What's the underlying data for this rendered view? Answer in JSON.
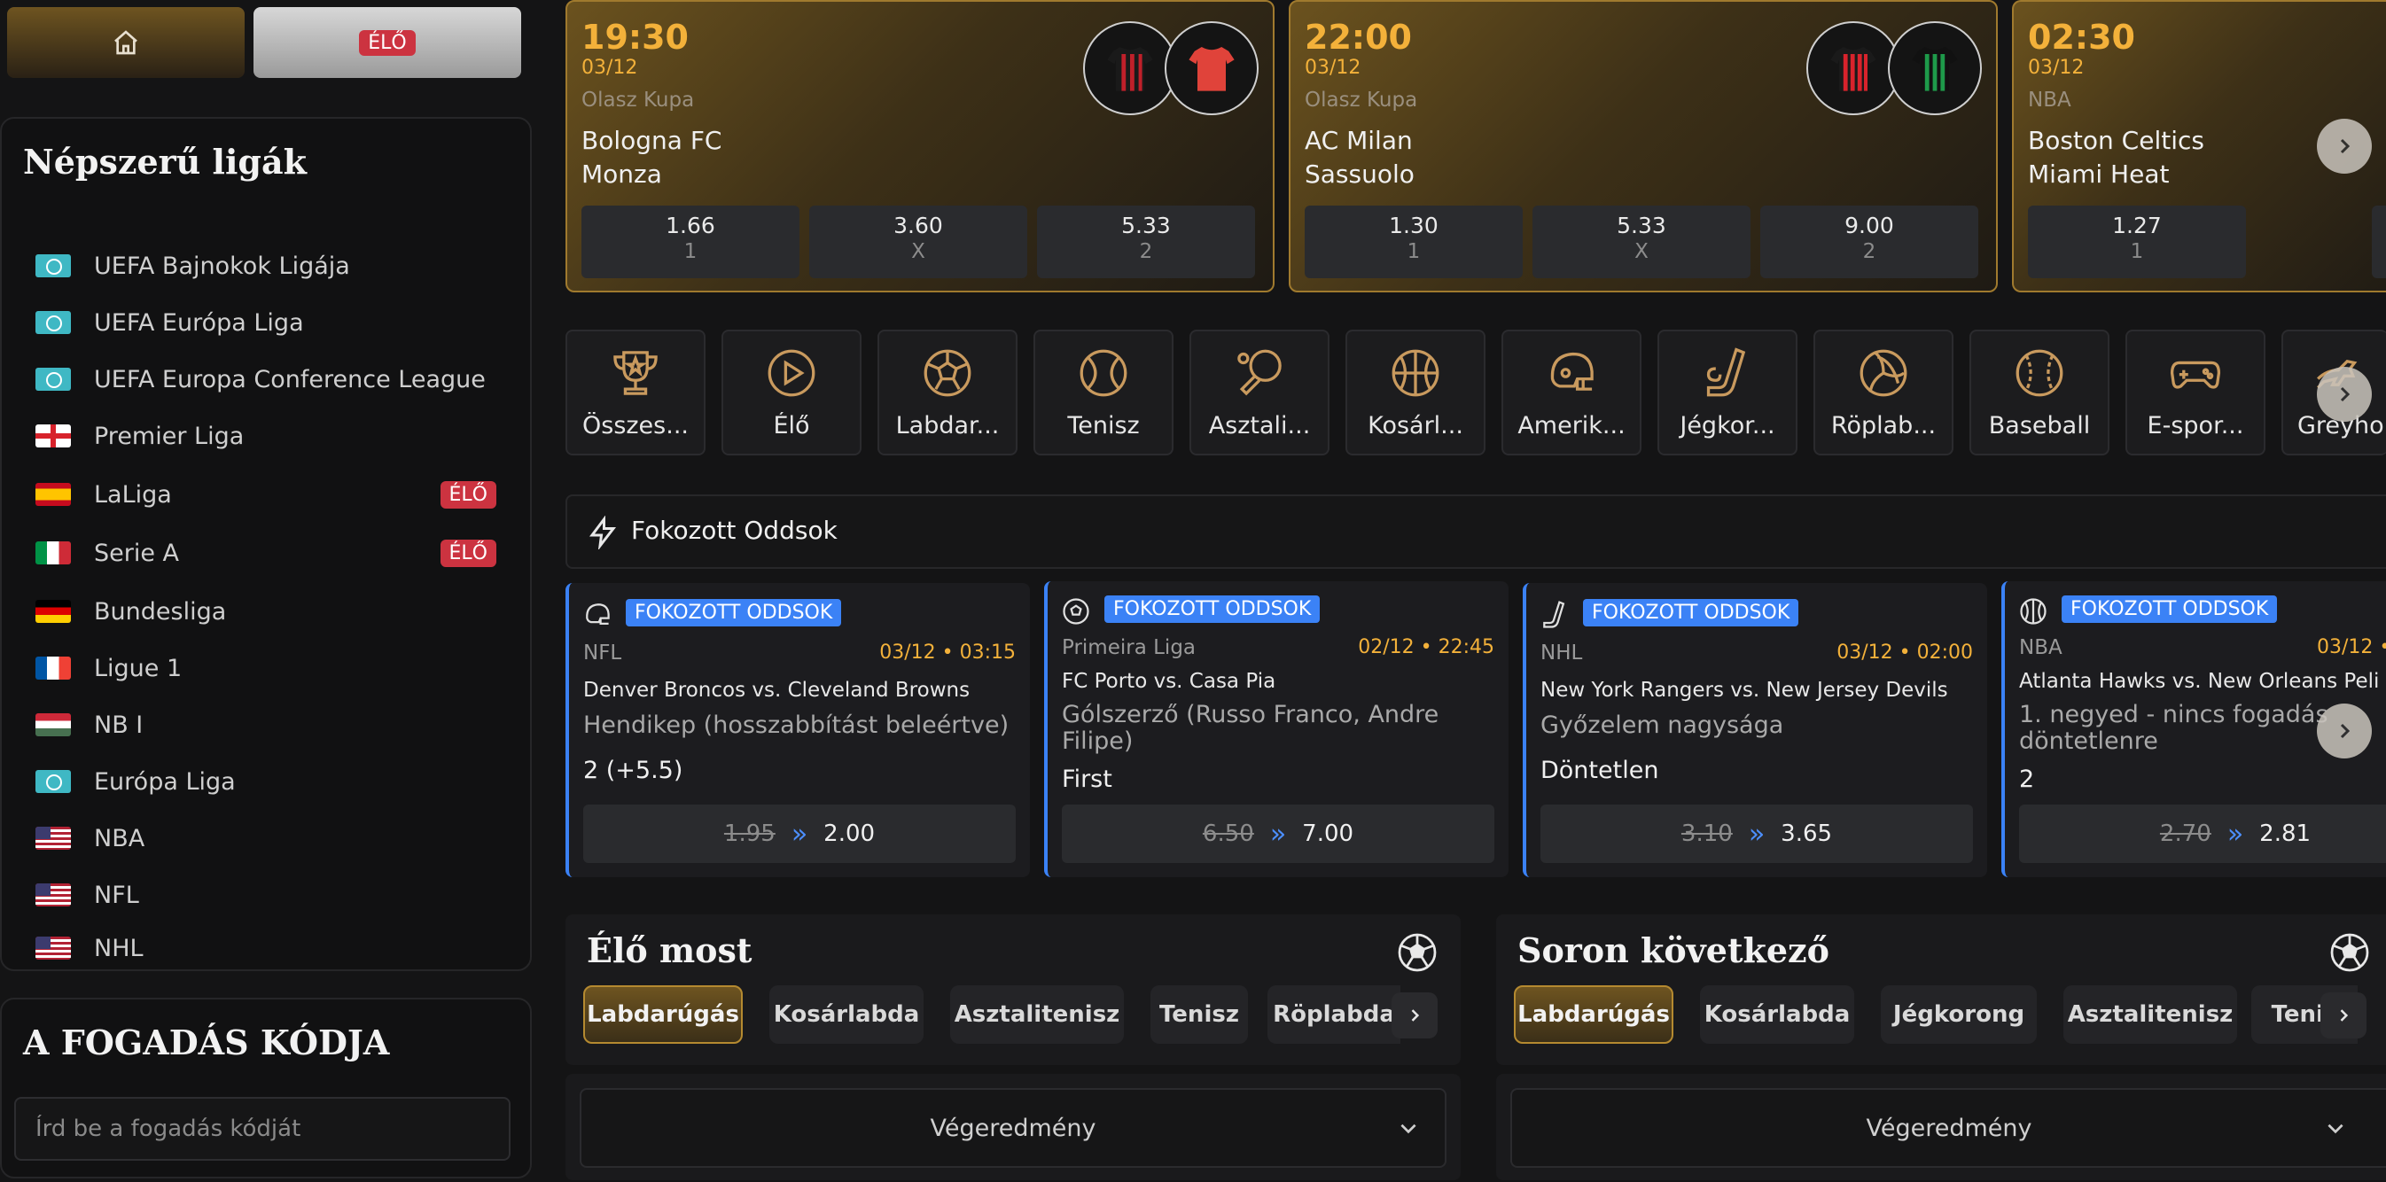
{
  "nav": {
    "home_icon": "home-icon",
    "live_label": "ÉLŐ"
  },
  "popular": {
    "title": "Népszerű ligák",
    "leagues": [
      {
        "label": "UEFA Bajnokok Ligája",
        "flag": "globe",
        "badge": ""
      },
      {
        "label": "UEFA Európa Liga",
        "flag": "globe",
        "badge": ""
      },
      {
        "label": "UEFA Europa Conference League",
        "flag": "globe",
        "badge": ""
      },
      {
        "label": "Premier Liga",
        "flag": "england",
        "badge": ""
      },
      {
        "label": "LaLiga",
        "flag": "spain",
        "badge": "ÉLŐ"
      },
      {
        "label": "Serie A",
        "flag": "italy",
        "badge": "ÉLŐ"
      },
      {
        "label": "Bundesliga",
        "flag": "germany",
        "badge": ""
      },
      {
        "label": "Ligue 1",
        "flag": "france",
        "badge": ""
      },
      {
        "label": "NB I",
        "flag": "hungary",
        "badge": ""
      },
      {
        "label": "Európa Liga",
        "flag": "globe",
        "badge": ""
      },
      {
        "label": "NBA",
        "flag": "usa",
        "badge": ""
      },
      {
        "label": "NFL",
        "flag": "usa",
        "badge": ""
      },
      {
        "label": "NHL",
        "flag": "usa",
        "badge": ""
      }
    ]
  },
  "bet_code": {
    "title": "A FOGADÁS KÓDJA",
    "placeholder": "Írd be a fogadás kódját"
  },
  "matches": [
    {
      "time": "19:30",
      "date": "03/12",
      "league": "Olasz Kupa",
      "home": "Bologna FC",
      "away": "Monza",
      "odds": [
        {
          "value": "1.66",
          "key": "1"
        },
        {
          "value": "3.60",
          "key": "X"
        },
        {
          "value": "5.33",
          "key": "2"
        }
      ]
    },
    {
      "time": "22:00",
      "date": "03/12",
      "league": "Olasz Kupa",
      "home": "AC Milan",
      "away": "Sassuolo",
      "odds": [
        {
          "value": "1.30",
          "key": "1"
        },
        {
          "value": "5.33",
          "key": "X"
        },
        {
          "value": "9.00",
          "key": "2"
        }
      ]
    },
    {
      "time": "02:30",
      "date": "03/12",
      "league": "NBA",
      "home": "Boston Celtics",
      "away": "Miami Heat",
      "odds": [
        {
          "value": "1.27",
          "key": "1"
        }
      ]
    }
  ],
  "sports": [
    {
      "label": "Összes...",
      "icon": "trophy-icon"
    },
    {
      "label": "Élő",
      "icon": "play-icon"
    },
    {
      "label": "Labdar...",
      "icon": "soccer-ball-icon"
    },
    {
      "label": "Tenisz",
      "icon": "tennis-ball-icon"
    },
    {
      "label": "Asztali...",
      "icon": "table-tennis-icon"
    },
    {
      "label": "Kosárl...",
      "icon": "basketball-icon"
    },
    {
      "label": "Amerik...",
      "icon": "football-helmet-icon"
    },
    {
      "label": "Jégkor...",
      "icon": "hockey-stick-icon"
    },
    {
      "label": "Röplab...",
      "icon": "volleyball-icon"
    },
    {
      "label": "Baseball",
      "icon": "baseball-icon"
    },
    {
      "label": "E-spor...",
      "icon": "gamepad-icon"
    },
    {
      "label": "Greyho...",
      "icon": "greyhound-icon"
    }
  ],
  "boosted": {
    "title": "Fokozott Oddsok",
    "items": [
      {
        "tag": "FOKOZOTT ODDSOK",
        "league": "NFL",
        "when": "03/12 • 03:15",
        "match": "Denver Broncos vs. Cleveland Browns",
        "market": "Hendikep (hosszabbítást beleértve)",
        "selection": "2 (+5.5)",
        "old": "1.95",
        "new": "2.00",
        "icon": "football-helmet-icon"
      },
      {
        "tag": "FOKOZOTT ODDSOK",
        "league": "Primeira Liga",
        "when": "02/12 • 22:45",
        "match": "FC Porto vs. Casa Pia",
        "market": "Gólszerző (Russo Franco, Andre Filipe)",
        "selection": "First",
        "old": "6.50",
        "new": "7.00",
        "icon": "soccer-ball-icon"
      },
      {
        "tag": "FOKOZOTT ODDSOK",
        "league": "NHL",
        "when": "03/12 • 02:00",
        "match": "New York Rangers vs. New Jersey Devils",
        "market": "Győzelem nagysága",
        "selection": "Döntetlen",
        "old": "3.10",
        "new": "3.65",
        "icon": "hockey-stick-icon"
      },
      {
        "tag": "FOKOZOTT ODDSOK",
        "league": "NBA",
        "when": "03/12 •",
        "match": "Atlanta Hawks vs. New Orleans Peli",
        "market": "1. negyed - nincs fogadás döntetlenre",
        "selection": "2",
        "old": "2.70",
        "new": "2.81",
        "icon": "basketball-icon"
      }
    ]
  },
  "live_now": {
    "title": "Élő most",
    "tabs": [
      "Labdarúgás",
      "Kosárlabda",
      "Asztalitenisz",
      "Tenisz",
      "Röplabda"
    ],
    "market": "Végeredmény"
  },
  "upcoming": {
    "title": "Soron következő",
    "tabs": [
      "Labdarúgás",
      "Kosárlabda",
      "Jégkorong",
      "Asztalitenisz",
      "Tenis"
    ],
    "market": "Végeredmény"
  },
  "colors": {
    "accent_gold": "#f3b13a",
    "live_red": "#cc3340",
    "boost_blue": "#3b82f6"
  }
}
